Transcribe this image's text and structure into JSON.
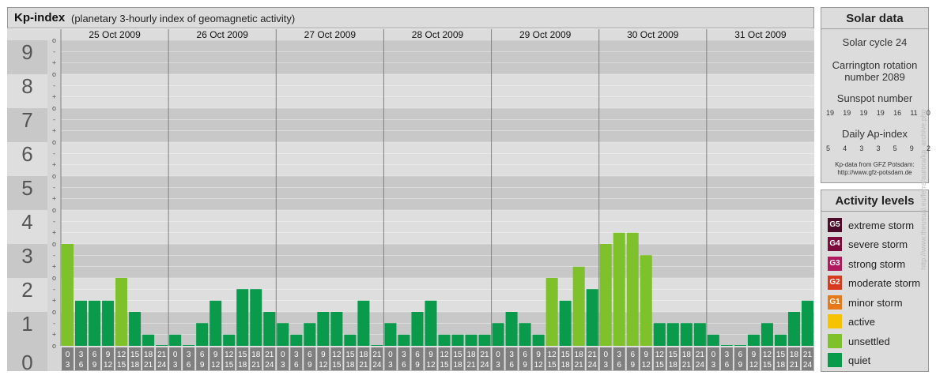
{
  "title": {
    "main": "Kp-index",
    "sub": "(planetary 3-hourly index of geomagnetic activity)"
  },
  "chart_data": {
    "type": "bar",
    "days": [
      "25 Oct 2009",
      "26 Oct 2009",
      "27 Oct 2009",
      "28 Oct 2009",
      "29 Oct 2009",
      "30 Oct 2009",
      "31 Oct 2009"
    ],
    "interval_labels": [
      [
        "0",
        "3"
      ],
      [
        "3",
        "6"
      ],
      [
        "6",
        "9"
      ],
      [
        "9",
        "12"
      ],
      [
        "12",
        "15"
      ],
      [
        "15",
        "18"
      ],
      [
        "18",
        "21"
      ],
      [
        "21",
        "24"
      ]
    ],
    "ylim": [
      0,
      9
    ],
    "y_ticks": [
      "0",
      "1",
      "2",
      "3",
      "4",
      "5",
      "6",
      "7",
      "8",
      "9"
    ],
    "sub_ticks": [
      "-",
      "o",
      "+"
    ],
    "kp_values": [
      [
        3.0,
        1.33,
        1.33,
        1.33,
        2.0,
        1.0,
        0.33,
        0.0
      ],
      [
        0.33,
        0.0,
        0.67,
        1.33,
        0.33,
        1.67,
        1.67,
        1.0
      ],
      [
        0.67,
        0.33,
        0.67,
        1.0,
        1.0,
        0.33,
        1.33,
        0.0
      ],
      [
        0.67,
        0.33,
        1.0,
        1.33,
        0.33,
        0.33,
        0.33,
        0.33
      ],
      [
        0.67,
        1.0,
        0.67,
        0.33,
        2.0,
        1.33,
        2.33,
        1.67
      ],
      [
        3.0,
        3.33,
        3.33,
        2.67,
        0.67,
        0.67,
        0.67,
        0.67
      ],
      [
        0.33,
        0.0,
        0.0,
        0.33,
        0.67,
        0.33,
        1.0,
        1.33
      ]
    ],
    "colors": {
      "quiet": "#099a4b",
      "unsettled": "#7ec12a",
      "grid_band_dark": "#c8c8c8",
      "grid_band_light": "#dedede",
      "axis_box": "#7f7f7f"
    }
  },
  "solar_data": {
    "heading": "Solar data",
    "cycle": "Solar cycle 24",
    "carrington_line1": "Carrington rotation",
    "carrington_line2": "number 2089",
    "sunspot_label": "Sunspot number",
    "sunspot_values": [
      "19",
      "19",
      "19",
      "19",
      "16",
      "11",
      "0"
    ],
    "ap_label": "Daily Ap-index",
    "ap_values": [
      "5",
      "4",
      "3",
      "3",
      "5",
      "9",
      "2"
    ],
    "source_line1": "Kp-data from GFZ Potsdam:",
    "source_line2": "http://www.gfz-potsdam.de"
  },
  "activity_levels": {
    "heading": "Activity levels",
    "items": [
      {
        "code": "G5",
        "label": "extreme storm",
        "color": "#4d0b2a"
      },
      {
        "code": "G4",
        "label": "severe storm",
        "color": "#7a0b3a"
      },
      {
        "code": "G3",
        "label": "strong storm",
        "color": "#b0195b"
      },
      {
        "code": "G2",
        "label": "moderate storm",
        "color": "#d83a1f"
      },
      {
        "code": "G1",
        "label": "minor storm",
        "color": "#e8791a"
      },
      {
        "code": "",
        "label": "active",
        "color": "#f7c200"
      },
      {
        "code": "",
        "label": "unsettled",
        "color": "#7ec12a"
      },
      {
        "code": "",
        "label": "quiet",
        "color": "#099a4b"
      }
    ]
  },
  "watermark": "http://www.theusual.eu/ferra/aurora/kp_archive.php"
}
